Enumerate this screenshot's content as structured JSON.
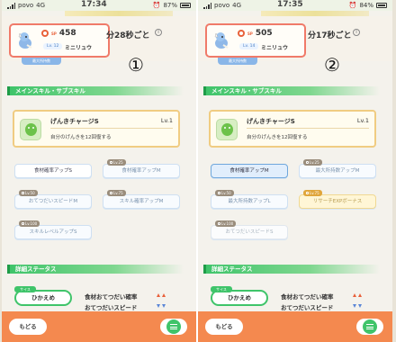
{
  "panels": [
    {
      "status": {
        "carrier": "povo",
        "network": "4G",
        "time": "17:34",
        "battery": "87%",
        "battery_level": 0.87
      },
      "pokemon": {
        "sp_label": "SP",
        "sp": "458",
        "level": "Lv. 12",
        "name": "ミニリュウ"
      },
      "timer_text": "分28秒ごと",
      "info_glyph": "i",
      "compare_label": "①",
      "tab_label": "最大所持数",
      "section_main": "メインスキル・サブスキル",
      "main_skill": {
        "name": "げんきチャージS",
        "level": "Lv.1",
        "desc": "自分のげんきを12回復する"
      },
      "sub_skills": [
        {
          "label": "食材確率アップS",
          "lv": "",
          "style": "normal"
        },
        {
          "label": "食材確率アップM",
          "lv": "Lv.25",
          "style": "locked"
        },
        {
          "label": "おてつだいスピードM",
          "lv": "Lv.50",
          "style": "locked"
        },
        {
          "label": "スキル確率アップM",
          "lv": "Lv.75",
          "style": "locked"
        },
        {
          "label": "スキルレベルアップS",
          "lv": "Lv.100",
          "style": "locked"
        }
      ],
      "section_stats": "詳細ステータス",
      "subtag": "サイス",
      "nature": "ひかえめ",
      "stat1": "食材おてつだい確率",
      "stat2": "おてつだいスピード",
      "back_label": "もどる"
    },
    {
      "status": {
        "carrier": "povo",
        "network": "4G",
        "time": "17:35",
        "battery": "84%",
        "battery_level": 0.84
      },
      "pokemon": {
        "sp_label": "SP",
        "sp": "505",
        "level": "Lv. 14",
        "name": "ミニリュウ"
      },
      "timer_text": "分17秒ごと",
      "info_glyph": "i",
      "compare_label": "②",
      "tab_label": "最大所持数",
      "section_main": "メインスキル・サブスキル",
      "main_skill": {
        "name": "げんきチャージS",
        "level": "Lv.1",
        "desc": "自分のげんきを12回復する"
      },
      "sub_skills": [
        {
          "label": "食材確率アップM",
          "lv": "",
          "style": "active"
        },
        {
          "label": "最大所持数アップM",
          "lv": "Lv.25",
          "style": "locked"
        },
        {
          "label": "最大所持数アップL",
          "lv": "Lv.50",
          "style": "locked"
        },
        {
          "label": "リサーチEXPボーナス",
          "lv": "Lv.75",
          "style": "gold"
        },
        {
          "label": "おてつだいスピードS",
          "lv": "Lv.100",
          "style": "faded"
        }
      ],
      "section_stats": "詳細ステータス",
      "subtag": "サイス",
      "nature": "ひかえめ",
      "stat1": "食材おてつだい確率",
      "stat2": "おてつだいスピード",
      "back_label": "もどる"
    }
  ]
}
